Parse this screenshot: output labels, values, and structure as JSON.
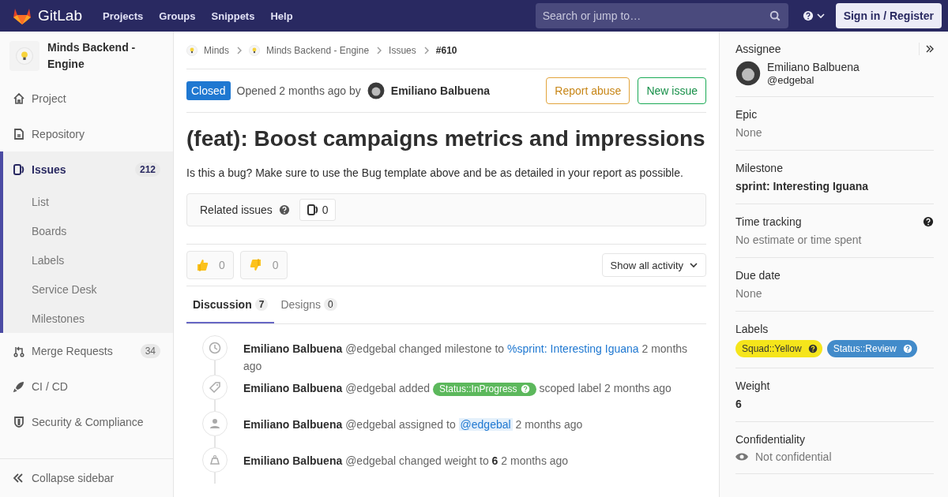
{
  "topbar": {
    "brand": "GitLab",
    "nav": [
      "Projects",
      "Groups",
      "Snippets",
      "Help"
    ],
    "search": {
      "placeholder": "Search or jump to…"
    },
    "sign_in": "Sign in / Register"
  },
  "sidebar": {
    "project": "Minds Backend - Engine",
    "items": [
      {
        "label": "Project",
        "selected": false
      },
      {
        "label": "Repository",
        "selected": false
      },
      {
        "label": "Issues",
        "count": "212",
        "selected": true,
        "expanded": true,
        "children": [
          {
            "label": "List",
            "selected": false
          },
          {
            "label": "Boards",
            "selected": false
          },
          {
            "label": "Labels",
            "selected": false
          },
          {
            "label": "Service Desk",
            "selected": false
          },
          {
            "label": "Milestones",
            "selected": false
          }
        ]
      },
      {
        "label": "Merge Requests",
        "count": "34",
        "selected": false
      },
      {
        "label": "CI / CD",
        "selected": false
      },
      {
        "label": "Security & Compliance",
        "selected": false
      }
    ],
    "collapse": "Collapse sidebar"
  },
  "breadcrumbs": [
    {
      "text": "Minds",
      "kind": "group"
    },
    {
      "text": "Minds Backend - Engine",
      "kind": "group"
    },
    {
      "text": "Issues",
      "kind": "link"
    },
    {
      "text": "#610",
      "kind": "current"
    }
  ],
  "issue": {
    "status": "Closed",
    "opened": "Opened 2 months ago by",
    "author": "Emiliano Balbuena",
    "report": "Report abuse",
    "new_issue": "New issue",
    "title": "(feat): Boost campaigns metrics and impressions",
    "description": "Is this a bug? Make sure to use the Bug template above and be as detailed in your report as possible.",
    "related": {
      "label": "Related issues",
      "count": "0"
    },
    "reactions": [
      {
        "kind": "up",
        "count": "0"
      },
      {
        "kind": "down",
        "count": "0"
      }
    ],
    "activity_filter": "Show all activity"
  },
  "tabs": [
    {
      "label": "Discussion",
      "count": "7",
      "selected": true
    },
    {
      "label": "Designs",
      "count": "0",
      "selected": false
    }
  ],
  "activity": [
    {
      "author": "Emiliano Balbuena",
      "parts": [
        {
          "kind": "text",
          "text": "@edgebal changed milestone to"
        },
        {
          "kind": "link",
          "text": "%sprint: Interesting Iguana"
        },
        {
          "kind": "text",
          "text": "2 months ago"
        }
      ]
    },
    {
      "author": "Emiliano Balbuena",
      "parts": [
        {
          "kind": "text",
          "text": "@edgebal added"
        },
        {
          "kind": "label",
          "text": "Status::InProgress",
          "color": "#5cb85c"
        },
        {
          "kind": "text",
          "text": "scoped label 2 months ago"
        }
      ]
    },
    {
      "author": "Emiliano Balbuena",
      "parts": [
        {
          "kind": "text",
          "text": "@edgebal assigned to"
        },
        {
          "kind": "mention",
          "text": "@edgebal"
        },
        {
          "kind": "text",
          "text": "2 months ago"
        }
      ]
    },
    {
      "author": "Emiliano Balbuena",
      "parts": [
        {
          "kind": "text",
          "text": "@edgebal changed weight to **6** 2 months ago"
        }
      ]
    }
  ],
  "right": {
    "assignee": {
      "title": "Assignee",
      "name": "Emiliano Balbuena",
      "handle": "@edgebal"
    },
    "sections": [
      {
        "title": "Epic",
        "kind": "muted",
        "value": "None"
      },
      {
        "title": "Milestone",
        "kind": "strong",
        "value": "sprint: Interesting Iguana"
      },
      {
        "title": "Time tracking",
        "kind": "muted",
        "value": "No estimate or time spent",
        "help": true
      },
      {
        "title": "Due date",
        "kind": "muted",
        "value": "None"
      },
      {
        "title": "Labels",
        "kind": "labels",
        "labels": [
          {
            "text": "Squad::Yellow",
            "color": "#f5e51b"
          },
          {
            "text": "Status::Review",
            "color": "#428bca"
          }
        ]
      },
      {
        "title": "Weight",
        "kind": "strong",
        "value": "6"
      },
      {
        "title": "Confidentiality",
        "kind": "eye",
        "value": "Not confidential"
      }
    ]
  }
}
